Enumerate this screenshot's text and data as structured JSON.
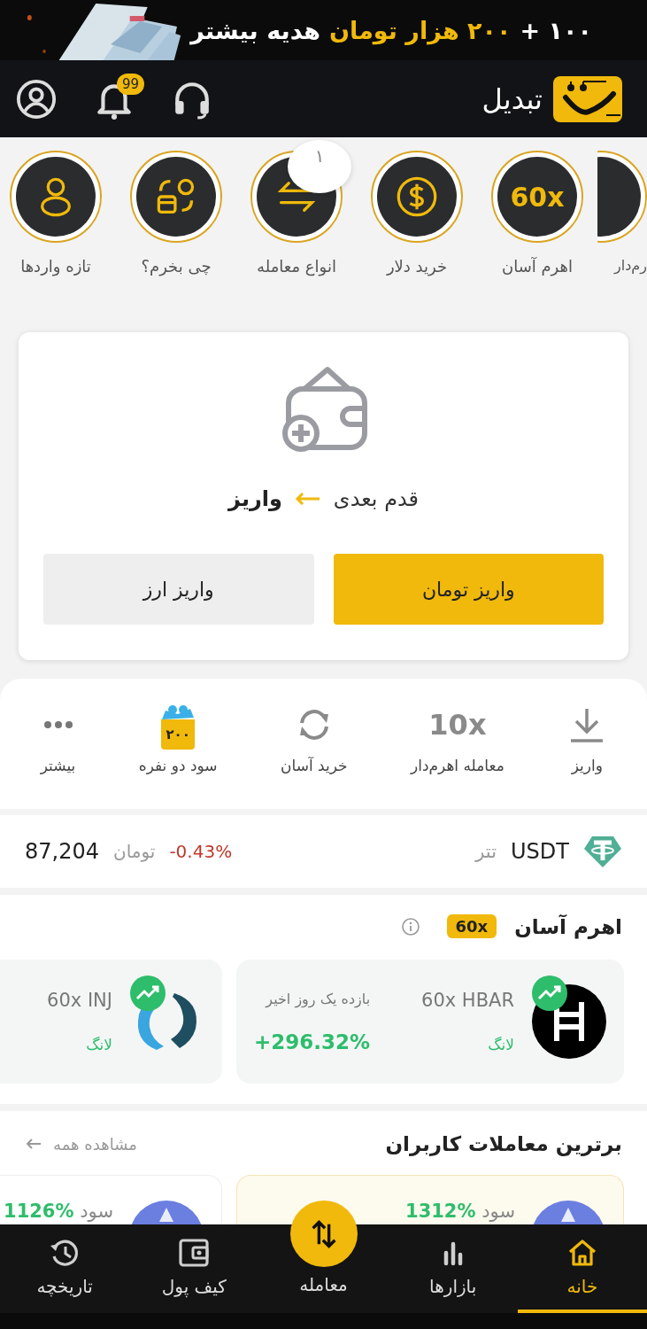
{
  "banner": {
    "parts": [
      {
        "text": "۱۰۰ +",
        "highlight": false
      },
      {
        "text": "۲۰۰ هزار تومان",
        "highlight": true
      },
      {
        "text": "هدیه بیشتر",
        "highlight": false
      }
    ]
  },
  "header": {
    "brand": "تبدیل",
    "notification_count": "99"
  },
  "shortcuts": [
    {
      "label": "رم‌دار",
      "kind": "blank",
      "cut": true
    },
    {
      "label": "اهرم آسان",
      "kind": "text",
      "icon_text": "60x",
      "cut": false
    },
    {
      "label": "خرید دلار",
      "kind": "dollar",
      "cut": false
    },
    {
      "label": "انواع معامله",
      "kind": "exchange",
      "badge": "۱",
      "cut": false
    },
    {
      "label": "چی بخرم؟",
      "kind": "swap-cards",
      "cut": false
    },
    {
      "label": "تازه واردها",
      "kind": "person",
      "cut": false
    }
  ],
  "deposit": {
    "step_label": "قدم بعدی",
    "step_target": "واریز",
    "buttons": [
      {
        "label": "واریز تومان",
        "primary": true
      },
      {
        "label": "واریز ارز",
        "primary": false
      }
    ]
  },
  "quick_actions": [
    {
      "kind": "download",
      "label": "واریز"
    },
    {
      "kind": "text",
      "icon_text": "10x",
      "label": "معامله اهرم‌دار"
    },
    {
      "kind": "refresh",
      "label": "خرید آسان"
    },
    {
      "kind": "gift",
      "icon_text": "۲۰۰",
      "label": "سود دو نفره"
    },
    {
      "kind": "more",
      "label": "بیشتر"
    }
  ],
  "ticker": {
    "symbol": "USDT",
    "name": "تتر",
    "change": "-0.43%",
    "unit": "تومان",
    "price": "87,204"
  },
  "leverage": {
    "title": "اهرم آسان",
    "badge": "60x",
    "cards": [
      {
        "kind": "hbar",
        "symbol": "HBAR",
        "leverage": "60x",
        "side": "لانگ",
        "return_label": "بازده یک روز اخیر",
        "return_value": "+296.32%"
      },
      {
        "kind": "inj",
        "symbol": "INJ",
        "leverage": "60x",
        "side": "لانگ"
      }
    ]
  },
  "top_trades": {
    "title": "برترین معاملات کاربران",
    "view_all": "مشاهده همه",
    "cards": [
      {
        "profit_label": "سود",
        "profit": "1312%",
        "highlighted": true
      },
      {
        "profit_label": "سود",
        "profit": "1126%",
        "highlighted": false
      }
    ]
  },
  "nav": [
    {
      "kind": "home",
      "label": "خانه",
      "selected": true
    },
    {
      "kind": "markets",
      "label": "بازارها",
      "selected": false
    },
    {
      "kind": "trade",
      "label": "معامله",
      "selected": false
    },
    {
      "kind": "wallet",
      "label": "کیف پول",
      "selected": false
    },
    {
      "kind": "history",
      "label": "تاریخچه",
      "selected": false
    }
  ]
}
